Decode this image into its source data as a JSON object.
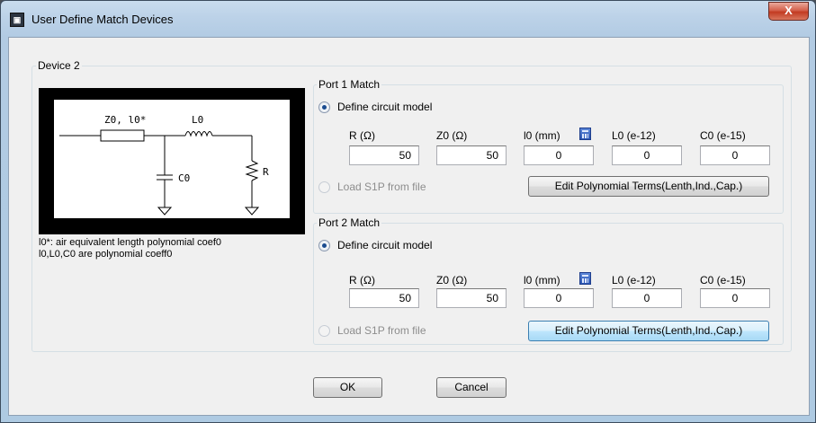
{
  "window": {
    "title": "User Define Match Devices",
    "close_label": "X"
  },
  "device_group": {
    "label": "Device 2",
    "schematic": {
      "z0_l0_label": "Z0, l0*",
      "l0_label": "L0",
      "c0_label": "C0",
      "r_label": "R"
    },
    "notes": [
      "l0*: air equivalent length polynomial coef0",
      "l0,L0,C0 are polynomial coeff0"
    ]
  },
  "ports": [
    {
      "label": "Port 1 Match",
      "define_label": "Define circuit model",
      "load_label": "Load S1P from file",
      "columns": [
        "R (Ω)",
        "Z0 (Ω)",
        "l0 (mm)",
        "L0 (e-12)",
        "C0 (e-15)"
      ],
      "values": [
        "50",
        "50",
        "0",
        "0",
        "0"
      ],
      "edit_label": "Edit Polynomial Terms(Lenth,Ind.,Cap.)"
    },
    {
      "label": "Port 2 Match",
      "define_label": "Define circuit model",
      "load_label": "Load S1P from file",
      "columns": [
        "R (Ω)",
        "Z0 (Ω)",
        "l0 (mm)",
        "L0 (e-12)",
        "C0 (e-15)"
      ],
      "values": [
        "50",
        "50",
        "0",
        "0",
        "0"
      ],
      "edit_label": "Edit Polynomial Terms(Lenth,Ind.,Cap.)"
    }
  ],
  "buttons": {
    "ok": "OK",
    "cancel": "Cancel"
  }
}
